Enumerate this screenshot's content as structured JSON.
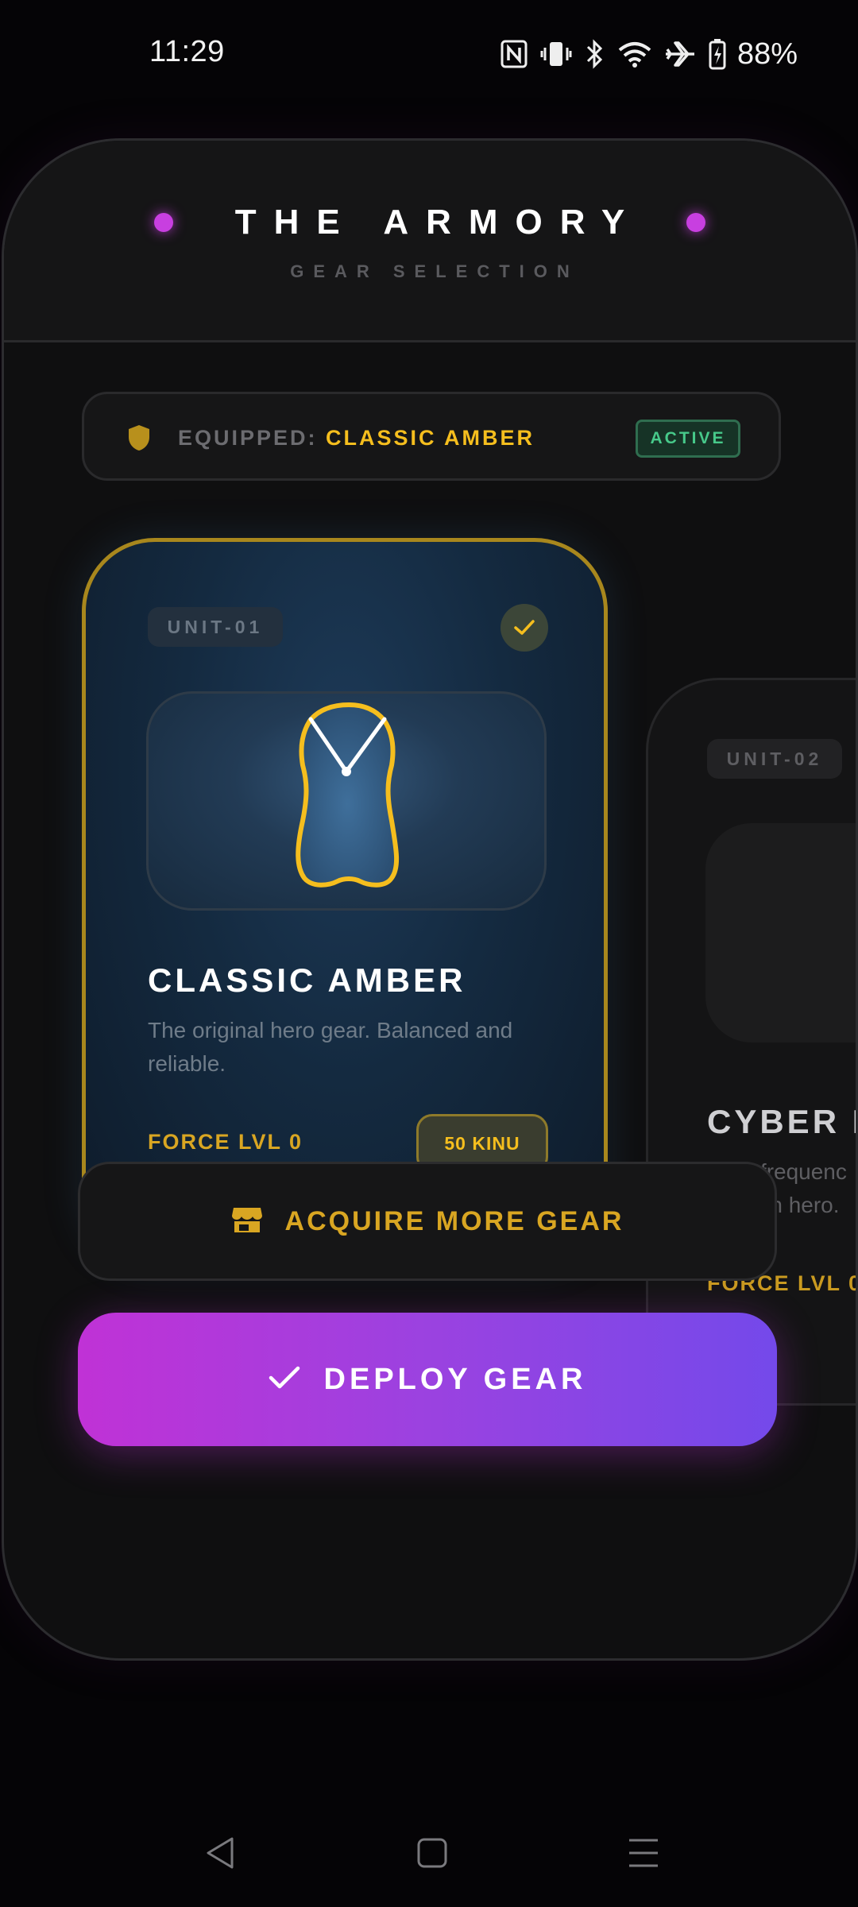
{
  "status_bar": {
    "time": "11:29",
    "battery": "88%",
    "icons": [
      "nfc-icon",
      "vibrate-icon",
      "bluetooth-icon",
      "wifi-icon",
      "airplane-icon",
      "battery-icon"
    ]
  },
  "header": {
    "title": "THE ARMORY",
    "subtitle": "GEAR SELECTION",
    "accent_color": "#c83fe0"
  },
  "equipped": {
    "label": "EQUIPPED:",
    "value": "CLASSIC AMBER",
    "status": "ACTIVE",
    "icon": "shield-icon"
  },
  "cards": [
    {
      "unit": "UNIT-01",
      "name": "CLASSIC AMBER",
      "description": "The original hero gear. Balanced and reliable.",
      "force": "FORCE LVL 0",
      "price": "50 KINU",
      "progress": 1.0,
      "selected": true,
      "icon": "gear-cape-icon",
      "accent_color": "#f5be1e"
    },
    {
      "unit": "UNIT-02",
      "name": "CYBER N",
      "description_line1": "High-frequenc",
      "description_line2": "modern hero.",
      "force": "FORCE LVL 0",
      "selected": false
    }
  ],
  "actions": {
    "acquire_label": "ACQUIRE MORE GEAR",
    "acquire_icon": "store-icon",
    "deploy_label": "DEPLOY GEAR",
    "deploy_icon": "check-icon",
    "deploy_gradient": [
      "#c032d6",
      "#7449ea"
    ]
  },
  "nav_bar": {
    "buttons": [
      "back-icon",
      "home-icon",
      "menu-icon"
    ]
  }
}
